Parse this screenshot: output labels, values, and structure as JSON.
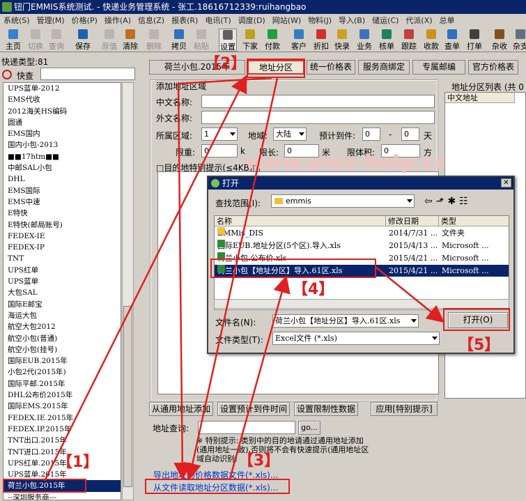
{
  "window": {
    "title": "钮门EMMIS系统测试. - 快递业务管理系统 - 张工.18616712339:ruihangbao"
  },
  "menu": [
    "系统(S)",
    "管理(M)",
    "价格(P)",
    "操作(A)",
    "信息(Z)",
    "报表(R)",
    "电讯(T)",
    "调度(D)",
    "网站(W)",
    "物料(J)",
    "导入(B)",
    "储运(C)",
    "代派(X)",
    "总单"
  ],
  "toolbar": [
    {
      "label": "主页",
      "icon": "home-icon",
      "disabled": false
    },
    {
      "label": "切换",
      "icon": "switch-icon",
      "disabled": true
    },
    {
      "label": "查询",
      "icon": "search-icon",
      "disabled": true
    },
    {
      "label": "保存",
      "icon": "save-icon",
      "disabled": false
    },
    {
      "label": "原值",
      "icon": "undo-icon",
      "disabled": true
    },
    {
      "label": "清除",
      "icon": "clear-icon",
      "disabled": false
    },
    {
      "label": "删除",
      "icon": "delete-icon",
      "disabled": true
    },
    {
      "label": "拷贝",
      "icon": "copy-icon",
      "disabled": false
    },
    {
      "label": "粘贴",
      "icon": "paste-icon",
      "disabled": true
    },
    {
      "label": "设置",
      "icon": "settings-icon",
      "disabled": false
    },
    {
      "label": "下家",
      "icon": "downstream-icon",
      "disabled": false
    },
    {
      "label": "付款",
      "icon": "payment-icon",
      "disabled": false
    },
    {
      "label": "客户",
      "icon": "customer-icon",
      "disabled": false
    },
    {
      "label": "折扣",
      "icon": "discount-icon",
      "disabled": false
    },
    {
      "label": "快录",
      "icon": "quick-entry-icon",
      "disabled": false
    },
    {
      "label": "业务",
      "icon": "business-icon",
      "disabled": false
    },
    {
      "label": "核单",
      "icon": "verify-icon",
      "disabled": false
    },
    {
      "label": "跟踪",
      "icon": "track-icon",
      "disabled": false
    },
    {
      "label": "收款",
      "icon": "receive-icon",
      "disabled": false
    },
    {
      "label": "查单",
      "icon": "lookup-icon",
      "disabled": false
    },
    {
      "label": "打单",
      "icon": "print-icon",
      "disabled": false
    },
    {
      "label": "杂收",
      "icon": "misc-icon",
      "disabled": false
    },
    {
      "label": "杂支",
      "icon": "expense-icon",
      "disabled": false
    }
  ],
  "left": {
    "header": "快递类型:81",
    "find_label": "快查",
    "items": [
      "UPS蓝单-2012",
      "EMS代收",
      "2012海关HS编码",
      "圆通",
      "EMS国内",
      "国内小包-2013",
      "■■17htm■■",
      "中邮SAL小包",
      "DHL",
      "EMS国际",
      "EMS中速",
      "E特快",
      "E特快(邮局账号)",
      "FEDEX-IE",
      "FEDEX-IP",
      "TNT",
      "UPS红单",
      "UPS蓝单",
      "大包SAL",
      "国际E邮宝",
      "海运大包",
      "航空大包2012",
      "航空小包(普通)",
      "航空小包(挂号)",
      "国际EUB.2015年",
      "小包2代(2015年)",
      "国际平邮.2015年",
      "DHL公布价2015年",
      "国际EMS.2015年",
      "FEDEX.IE.2015年",
      "FEDEX.IP.2015年",
      "TNT出口.2015年",
      "TNT进口.2015年",
      "UPS红单.2015年",
      "UPS蓝单.2015年",
      "荷兰小包.2015年",
      "--深圳服务商---"
    ],
    "selected_index": 35
  },
  "tabs": [
    "荷兰小包.2015年",
    "地址分区",
    "统一价格表",
    "服务商绑定",
    "专属邮编",
    "官方价格表"
  ],
  "form": {
    "group_title": "添加地址区域",
    "cn_name_label": "中文名称:",
    "foreign_name_label": "外文名称:",
    "region_label": "所属区域:",
    "region_value": "1",
    "area_label": "地域:",
    "area_value": "大陆",
    "eta_label": "预计到件:",
    "eta_from": "0",
    "eta_dash": "-",
    "eta_to": "0",
    "eta_unit": "天",
    "weight_label": "限重:",
    "weight_value": "0",
    "weight_unit": "k",
    "length_label": "限长:",
    "length_value": "0",
    "length_unit": "米",
    "volume_label": "限体积:",
    "volume_value": "0",
    "volume_unit": "方",
    "hint_label": "□目的地特别提示(≤4KB)□"
  },
  "right_list": {
    "title": "地址分区列表 (共 0",
    "col": "中文地址"
  },
  "bottom_buttons": [
    "从通用地址添加",
    "设置预计到件时间",
    "设置限制性数据",
    "应用[特别提示]"
  ],
  "query": {
    "label": "地址查询:",
    "go": "go..."
  },
  "notice": "※ 特别提示: 类别中的目的地请通过通用地址添加(通用地址一致),否则将不会有快速提示(通用地址区域自动识别!",
  "links": [
    "导出地址的价格数据文件(*.xls)...",
    "从文件读取地址分区数据(*.xls)..."
  ],
  "dialog": {
    "title": "打开",
    "lookin_label": "查找范围(I):",
    "lookin_value": "emmis",
    "cols": [
      "名称",
      "修改日期",
      "类型"
    ],
    "files": [
      {
        "name": "EMMis_DIS",
        "date": "2014/7/31 ...",
        "type": "文件夹",
        "kind": "folder"
      },
      {
        "name": "国际EUB.地址分区(5个区).导入.xls",
        "date": "2015/4/13 ...",
        "type": "Microsoft ...",
        "kind": "xls"
      },
      {
        "name": "荷兰小包.公布价.xls",
        "date": "2015/4/21 ...",
        "type": "Microsoft ...",
        "kind": "xls"
      },
      {
        "name": "荷兰小包【地址分区】导入.61区.xls",
        "date": "2015/4/21 ...",
        "type": "Microsoft ...",
        "kind": "xls"
      }
    ],
    "selected_file": 3,
    "filename_label": "文件名(N):",
    "filename_value": "荷兰小包【地址分区】导入.61区.xls",
    "filetype_label": "文件类型(T):",
    "filetype_value": "Excel文件 (*.xls)",
    "open_label": "打开(O)"
  },
  "annotations": [
    "【1】",
    "【2】",
    "【3】",
    "【4】",
    "【5】"
  ],
  "watermark": "www.ems-help.com",
  "colors": {
    "annotation": "#e02020",
    "titlebar": "#0a246a",
    "selection": "#0a246a",
    "link": "#0033cc"
  }
}
